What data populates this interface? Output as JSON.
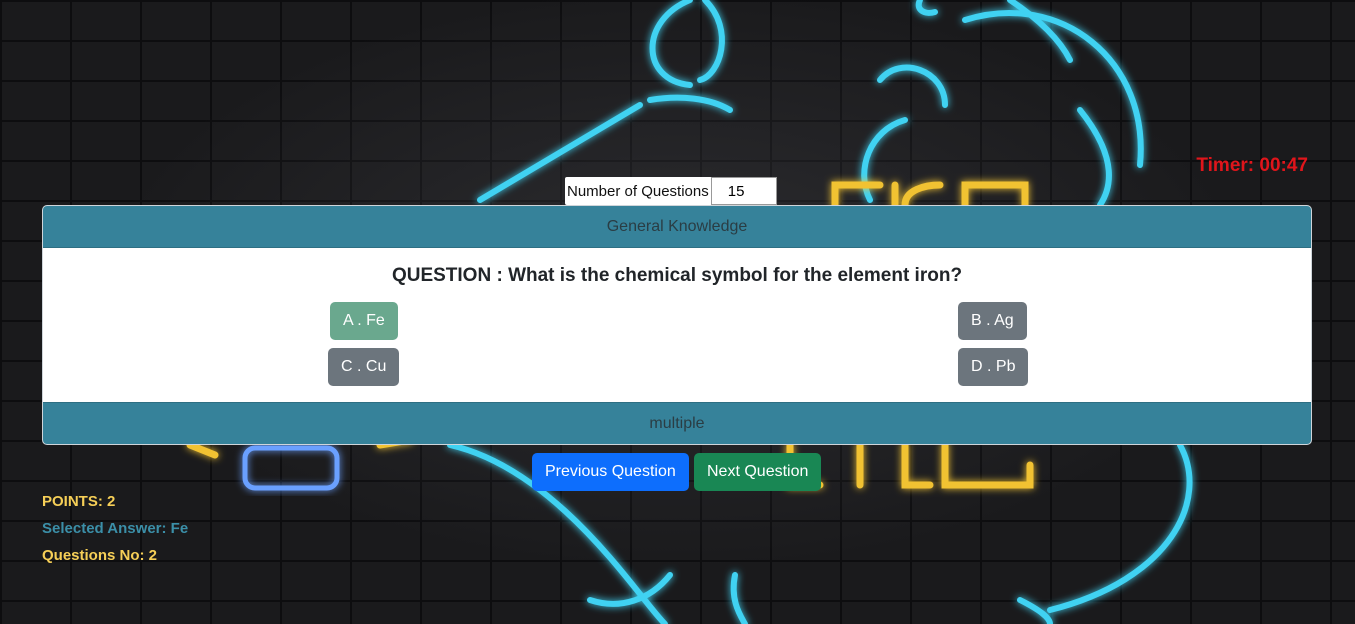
{
  "timer": {
    "text": "Timer: 00:47"
  },
  "settings": {
    "num_questions_label": "Number of Questions",
    "num_questions_value": "15"
  },
  "quiz": {
    "category": "General Knowledge",
    "question": "QUESTION : What is the chemical symbol for the element iron?",
    "type": "multiple",
    "answers": [
      {
        "label": "A . Fe",
        "selected": true
      },
      {
        "label": "B . Ag",
        "selected": false
      },
      {
        "label": "C . Cu",
        "selected": false
      },
      {
        "label": "D . Pb",
        "selected": false
      }
    ]
  },
  "nav": {
    "previous_label": "Previous Question",
    "next_label": "Next Question"
  },
  "stats": {
    "points": "POINTS: 2",
    "selected_answer": "Selected Answer: Fe",
    "question_no": "Questions No: 2"
  },
  "colors": {
    "timer": "#e0151b",
    "card_header": "#36829a",
    "selected_answer_button": "#6aa88e",
    "answer_button": "#6c757d",
    "previous_button": "#0d6efd",
    "next_button": "#198754",
    "points_text": "#f6cf57",
    "selected_answer_text": "#3b8fa8"
  }
}
